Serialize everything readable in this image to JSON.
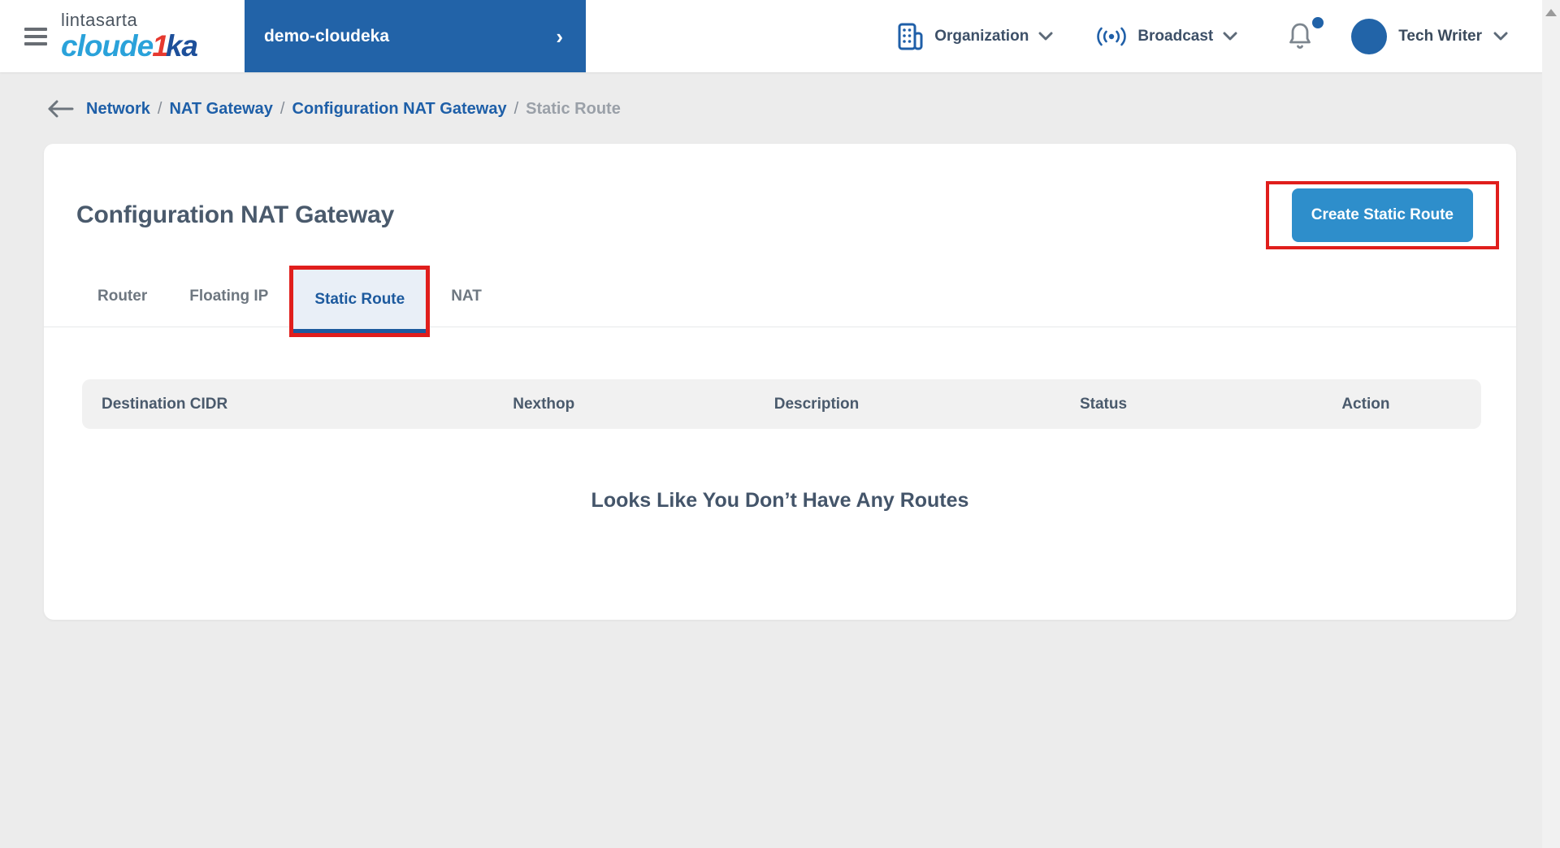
{
  "header": {
    "brand": {
      "top": "lintasarta",
      "cloud": "cloude",
      "one": "1",
      "ka": "ka"
    },
    "project": {
      "name": "demo-cloudeka",
      "chevron": "›"
    },
    "organization_label": "Organization",
    "broadcast_label": "Broadcast",
    "user_name": "Tech Writer"
  },
  "breadcrumb": {
    "separator": "/",
    "items": [
      {
        "label": "Network",
        "current": false
      },
      {
        "label": "NAT Gateway",
        "current": false
      },
      {
        "label": "Configuration NAT Gateway",
        "current": false
      },
      {
        "label": "Static Route",
        "current": true
      }
    ]
  },
  "page": {
    "title": "Configuration NAT Gateway",
    "create_button_label": "Create Static Route"
  },
  "tabs": [
    {
      "label": "Router",
      "active": false
    },
    {
      "label": "Floating IP",
      "active": false
    },
    {
      "label": "Static Route",
      "active": true
    },
    {
      "label": "NAT",
      "active": false
    }
  ],
  "table": {
    "columns": [
      "Destination CIDR",
      "Nexthop",
      "Description",
      "Status",
      "Action"
    ],
    "rows": [],
    "empty_message": "Looks Like You Don’t Have Any Routes"
  },
  "colors": {
    "brand_blue": "#2263a8",
    "icon_blue": "#1f5fa8",
    "button_blue": "#2e8ecb",
    "active_tab_blue": "#1d5a9e",
    "active_tab_bg": "#e9eff7",
    "annotation_red": "#e01e1c",
    "link_blue": "#1e5fa8",
    "heading_slate": "#4a5a6c",
    "page_bg": "#ececec",
    "table_header_bg": "#f1f1f1",
    "logo_light_blue": "#2aa2da",
    "logo_red": "#e6392f",
    "logo_dark_blue": "#1d4f9a"
  }
}
